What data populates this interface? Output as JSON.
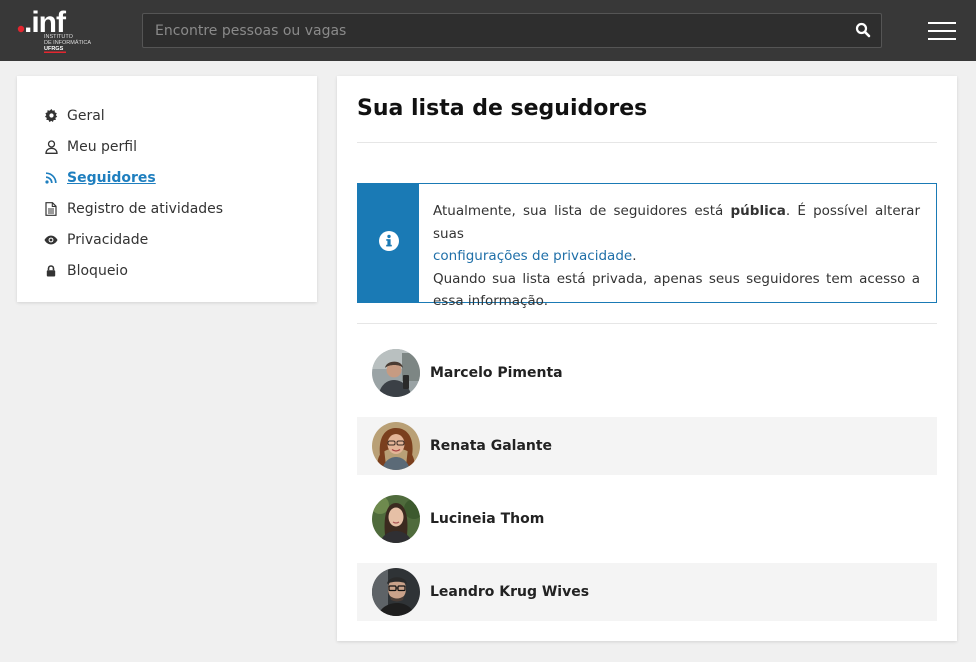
{
  "header": {
    "logo_text": ".inf",
    "logo_sub1": "INSTITUTO",
    "logo_sub2": "DE INFORMÁTICA",
    "logo_sub3": "UFRGS",
    "search_placeholder": "Encontre pessoas ou vagas",
    "search_icon": "search-icon",
    "menu_icon": "hamburger-menu-icon"
  },
  "sidebar": {
    "items": [
      {
        "label": "Geral",
        "icon": "gear-icon"
      },
      {
        "label": "Meu perfil",
        "icon": "user-icon"
      },
      {
        "label": "Seguidores",
        "icon": "rss-icon",
        "active": true
      },
      {
        "label": "Registro de atividades",
        "icon": "document-icon"
      },
      {
        "label": "Privacidade",
        "icon": "eye-icon"
      },
      {
        "label": "Bloqueio",
        "icon": "lock-icon"
      }
    ]
  },
  "main": {
    "title": "Sua lista de seguidores",
    "info": {
      "icon": "info-icon",
      "text_before": "Atualmente, sua lista de seguidores está ",
      "text_bold": "pública",
      "text_after": ". É possível alterar suas ",
      "link": "configurações de privacidade",
      "text_end": ".",
      "line2": "Quando sua lista está privada, apenas seus seguidores tem acesso a essa informação."
    },
    "followers": [
      {
        "name": "Marcelo Pimenta"
      },
      {
        "name": "Renata Galante"
      },
      {
        "name": "Lucineia Thom"
      },
      {
        "name": "Leandro Krug Wives"
      }
    ]
  },
  "colors": {
    "topbar": "#383838",
    "accent": "#1a7ab5",
    "logo_red": "#e3262f"
  }
}
